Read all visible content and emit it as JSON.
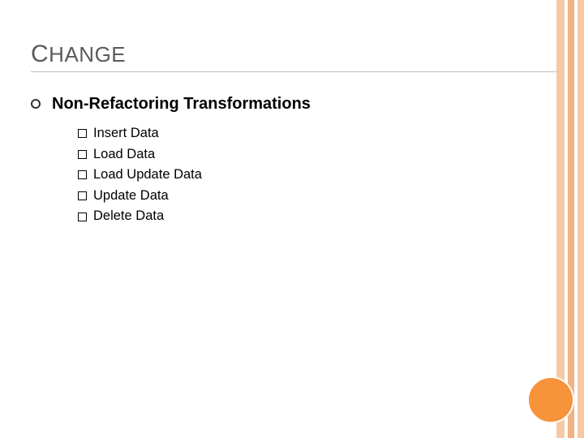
{
  "title": {
    "cap1": "C",
    "rest1": "HANGE"
  },
  "section": {
    "heading": "Non-Refactoring Transformations"
  },
  "items": [
    {
      "label": "Insert Data"
    },
    {
      "label": "Load Data"
    },
    {
      "label": "Load Update Data"
    },
    {
      "label": "Update Data"
    },
    {
      "label": "Delete Data"
    }
  ],
  "colors": {
    "stripe_light": "#f6c9a6",
    "stripe_mid": "#f4b183",
    "circle": "#f7933a"
  }
}
